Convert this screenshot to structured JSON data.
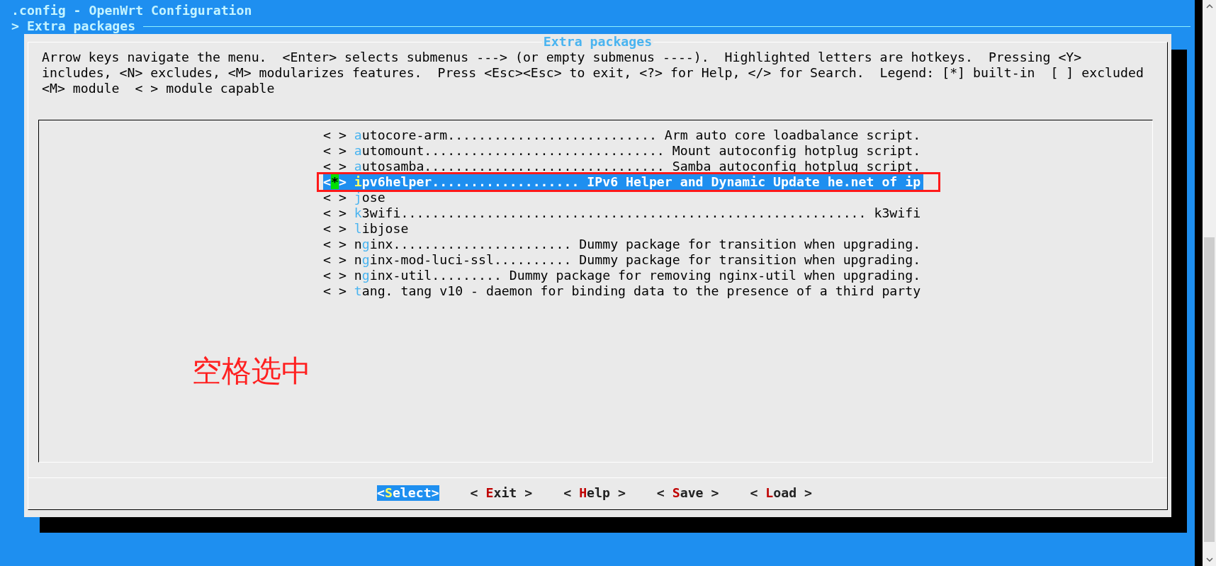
{
  "window": {
    "title": ".config - OpenWrt Configuration"
  },
  "breadcrumb": "> Extra packages",
  "dialog": {
    "title": "Extra packages",
    "help_lines": [
      "Arrow keys navigate the menu.  <Enter> selects submenus ---> (or empty submenus ----).  Highlighted letters are hotkeys.  Pressing <Y>",
      "includes, <N> excludes, <M> modularizes features.  Press <Esc><Esc> to exit, <?> for Help, </> for Search.  Legend: [*] built-in  [ ] excluded",
      "<M> module  < > module capable"
    ],
    "items": [
      {
        "state": "< >",
        "hotkey": "a",
        "rest": "utocore-arm........................... Arm auto core loadbalance script.",
        "selected": false,
        "boxed": false
      },
      {
        "state": "< >",
        "hotkey": "a",
        "rest": "utomount............................... Mount autoconfig hotplug script.",
        "selected": false,
        "boxed": false
      },
      {
        "state": "< >",
        "hotkey": "a",
        "rest": "utosamba............................... Samba autoconfig hotplug script.",
        "selected": false,
        "boxed": false
      },
      {
        "state": "<*>",
        "hotkey": "i",
        "rest": "pv6helper................... IPv6 Helper and Dynamic Update he.net of ip",
        "selected": true,
        "boxed": true
      },
      {
        "state": "< >",
        "hotkey": "j",
        "rest": "ose",
        "selected": false,
        "boxed": false
      },
      {
        "state": "< >",
        "hotkey": "k",
        "rest": "3wifi............................................................ k3wifi",
        "selected": false,
        "boxed": false
      },
      {
        "state": "< >",
        "hotkey": "l",
        "rest": "ibjose",
        "selected": false,
        "boxed": false
      },
      {
        "state": "< >",
        "lead": "n",
        "hotkey": "g",
        "rest": "inx....................... Dummy package for transition when upgrading.",
        "selected": false,
        "boxed": false
      },
      {
        "state": "< >",
        "lead": "n",
        "hotkey": "g",
        "rest": "inx-mod-luci-ssl.......... Dummy package for transition when upgrading.",
        "selected": false,
        "boxed": false
      },
      {
        "state": "< >",
        "lead": "n",
        "hotkey": "g",
        "rest": "inx-util......... Dummy package for removing nginx-util when upgrading.",
        "selected": false,
        "boxed": false
      },
      {
        "state": "< >",
        "hotkey": "t",
        "rest": "ang. tang v10 - daemon for binding data to the presence of a third party",
        "selected": false,
        "boxed": false
      }
    ],
    "buttons": [
      {
        "lead": "<",
        "hotkey": "S",
        "rest": "elect>",
        "selected": true
      },
      {
        "lead": "< ",
        "hotkey": "E",
        "rest": "xit >",
        "selected": false
      },
      {
        "lead": "< ",
        "hotkey": "H",
        "rest": "elp >",
        "selected": false
      },
      {
        "lead": "< ",
        "hotkey": "S",
        "rest": "ave >",
        "selected": false
      },
      {
        "lead": "< ",
        "hotkey": "L",
        "rest": "oad >",
        "selected": false
      }
    ]
  },
  "annotation": {
    "text": "空格选中"
  }
}
